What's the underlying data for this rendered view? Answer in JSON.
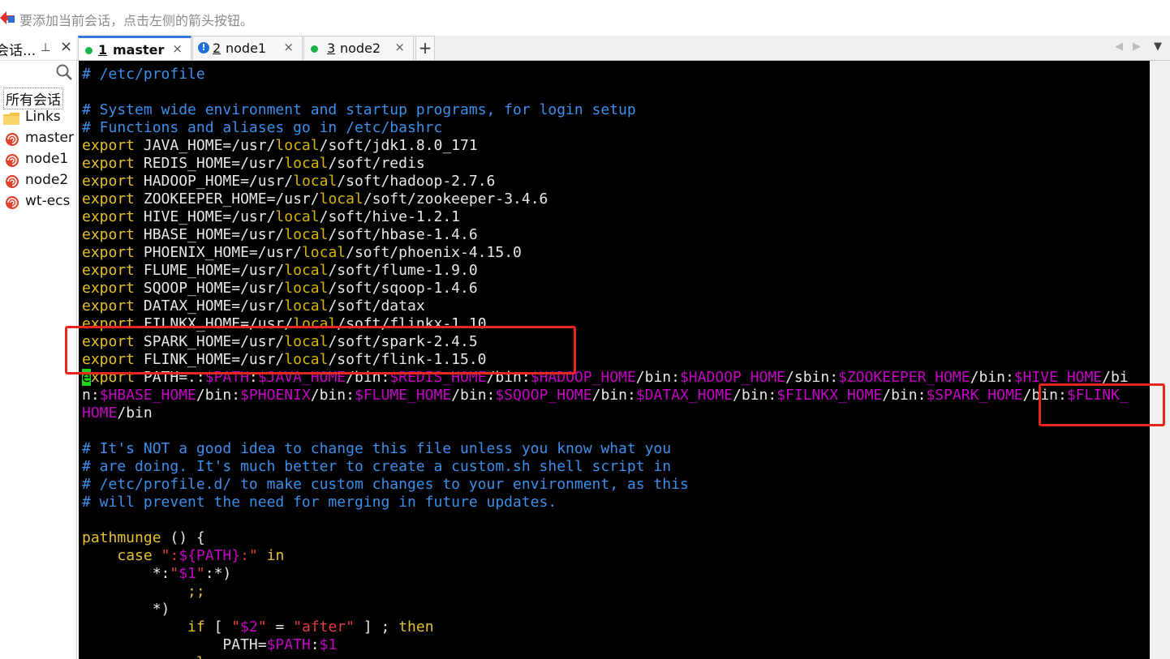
{
  "hint_bar": {
    "text": "要添加当前会话，点击左侧的箭头按钮。"
  },
  "sidebar": {
    "title": "会话...",
    "pin_glyph": "⊥",
    "close_glyph": "×",
    "tree": [
      {
        "label": "所有会话",
        "icon": "none"
      },
      {
        "label": "Links",
        "icon": "folder-icon"
      },
      {
        "label": "master",
        "icon": "session-snail-icon"
      },
      {
        "label": "node1",
        "icon": "session-snail-icon"
      },
      {
        "label": "node2",
        "icon": "session-snail-icon"
      },
      {
        "label": "wt-ecs",
        "icon": "session-snail-icon"
      }
    ]
  },
  "tabs": [
    {
      "num": "1",
      "name": "master",
      "status": "connected",
      "active": true,
      "close": "×"
    },
    {
      "num": "2",
      "name": "node1",
      "status": "warning",
      "active": false,
      "close": "×"
    },
    {
      "num": "3",
      "name": "node2",
      "status": "connected",
      "active": false,
      "close": "×"
    }
  ],
  "tab_controls": {
    "add": "+",
    "prev": "◀",
    "next": "▶",
    "menu": "▼"
  },
  "terminal": {
    "colors": {
      "background": "#000000",
      "comment": "#3b8eea",
      "keyword": "#e5c02a",
      "variable": "#c400c4",
      "string": "#e03c3c",
      "highlight_box": "#e5261b"
    },
    "lines": [
      [
        [
          "c",
          "# /etc/profile"
        ]
      ],
      [],
      [
        [
          "c",
          "# System wide environment and startup programs, for login setup"
        ]
      ],
      [
        [
          "c",
          "# Functions and aliases go in /etc/bashrc"
        ]
      ],
      [
        [
          "k",
          "export"
        ],
        [
          "p",
          " JAVA_HOME=/usr/"
        ],
        [
          "l",
          "local"
        ],
        [
          "p",
          "/soft/jdk1.8.0_171"
        ]
      ],
      [
        [
          "k",
          "export"
        ],
        [
          "p",
          " REDIS_HOME=/usr/"
        ],
        [
          "l",
          "local"
        ],
        [
          "p",
          "/soft/redis"
        ]
      ],
      [
        [
          "k",
          "export"
        ],
        [
          "p",
          " HADOOP_HOME=/usr/"
        ],
        [
          "l",
          "local"
        ],
        [
          "p",
          "/soft/hadoop-2.7.6"
        ]
      ],
      [
        [
          "k",
          "export"
        ],
        [
          "p",
          " ZOOKEEPER_HOME=/usr/"
        ],
        [
          "l",
          "local"
        ],
        [
          "p",
          "/soft/zookeeper-3.4.6"
        ]
      ],
      [
        [
          "k",
          "export"
        ],
        [
          "p",
          " HIVE_HOME=/usr/"
        ],
        [
          "l",
          "local"
        ],
        [
          "p",
          "/soft/hive-1.2.1"
        ]
      ],
      [
        [
          "k",
          "export"
        ],
        [
          "p",
          " HBASE_HOME=/usr/"
        ],
        [
          "l",
          "local"
        ],
        [
          "p",
          "/soft/hbase-1.4.6"
        ]
      ],
      [
        [
          "k",
          "export"
        ],
        [
          "p",
          " PHOENIX_HOME=/usr/"
        ],
        [
          "l",
          "local"
        ],
        [
          "p",
          "/soft/phoenix-4.15.0"
        ]
      ],
      [
        [
          "k",
          "export"
        ],
        [
          "p",
          " FLUME_HOME=/usr/"
        ],
        [
          "l",
          "local"
        ],
        [
          "p",
          "/soft/flume-1.9.0"
        ]
      ],
      [
        [
          "k",
          "export"
        ],
        [
          "p",
          " SQOOP_HOME=/usr/"
        ],
        [
          "l",
          "local"
        ],
        [
          "p",
          "/soft/sqoop-1.4.6"
        ]
      ],
      [
        [
          "k",
          "export"
        ],
        [
          "p",
          " DATAX_HOME=/usr/"
        ],
        [
          "l",
          "local"
        ],
        [
          "p",
          "/soft/datax"
        ]
      ],
      [
        [
          "k",
          "export"
        ],
        [
          "p",
          " FILNKX_HOME=/usr/"
        ],
        [
          "l",
          "local"
        ],
        [
          "p",
          "/soft/flinkx-1.10"
        ]
      ],
      [
        [
          "k",
          "export"
        ],
        [
          "p",
          " SPARK_HOME=/usr/"
        ],
        [
          "l",
          "local"
        ],
        [
          "p",
          "/soft/spark-2.4.5"
        ]
      ],
      [
        [
          "k",
          "export"
        ],
        [
          "p",
          " FLINK_HOME=/usr/"
        ],
        [
          "l",
          "local"
        ],
        [
          "p",
          "/soft/flink-1.15.0"
        ]
      ],
      [
        [
          "cur",
          "e"
        ],
        [
          "k",
          "xport"
        ],
        [
          "p",
          " PATH=.:"
        ],
        [
          "v",
          "$PATH"
        ],
        [
          "p",
          ":"
        ],
        [
          "v",
          "$JAVA_HOME"
        ],
        [
          "p",
          "/bin:"
        ],
        [
          "v",
          "$REDIS_HOME"
        ],
        [
          "p",
          "/bin:"
        ],
        [
          "v",
          "$HADOOP_HOME"
        ],
        [
          "p",
          "/bin:"
        ],
        [
          "v",
          "$HADOOP_HOME"
        ],
        [
          "p",
          "/sbin:"
        ],
        [
          "v",
          "$ZOOKEEPER_HOME"
        ],
        [
          "p",
          "/bin:"
        ],
        [
          "v",
          "$HIVE_HOME"
        ],
        [
          "p",
          "/bi"
        ]
      ],
      [
        [
          "p",
          "n:"
        ],
        [
          "v",
          "$HBASE_HOME"
        ],
        [
          "p",
          "/bin:"
        ],
        [
          "v",
          "$PHOENIX"
        ],
        [
          "p",
          "/bin:"
        ],
        [
          "v",
          "$FLUME_HOME"
        ],
        [
          "p",
          "/bin:"
        ],
        [
          "v",
          "$SQOOP_HOME"
        ],
        [
          "p",
          "/bin:"
        ],
        [
          "v",
          "$DATAX_HOME"
        ],
        [
          "p",
          "/bin:"
        ],
        [
          "v",
          "$FILNKX_HOME"
        ],
        [
          "p",
          "/bin:"
        ],
        [
          "v",
          "$SPARK_HOME"
        ],
        [
          "p",
          "/bin:"
        ],
        [
          "v",
          "$FLINK_"
        ]
      ],
      [
        [
          "v",
          "HOME"
        ],
        [
          "p",
          "/bin"
        ]
      ],
      [],
      [
        [
          "c",
          "# It's NOT a good idea to change this file unless you know what you"
        ]
      ],
      [
        [
          "c",
          "# are doing. It's much better to create a custom.sh shell script in"
        ]
      ],
      [
        [
          "c",
          "# /etc/profile.d/ to make custom changes to your environment, as this"
        ]
      ],
      [
        [
          "c",
          "# will prevent the need for merging in future updates."
        ]
      ],
      [],
      [
        [
          "k",
          "pathmunge"
        ],
        [
          "p",
          " () {"
        ]
      ],
      [
        [
          "p",
          "    "
        ],
        [
          "k",
          "case"
        ],
        [
          "p",
          " "
        ],
        [
          "s",
          "\":"
        ],
        [
          "v",
          "${PATH}"
        ],
        [
          "s",
          ":\""
        ],
        [
          "p",
          " "
        ],
        [
          "k",
          "in"
        ]
      ],
      [
        [
          "p",
          "        *:"
        ],
        [
          "s",
          "\""
        ],
        [
          "v",
          "$1"
        ],
        [
          "s",
          "\""
        ],
        [
          "p",
          ":*)"
        ]
      ],
      [
        [
          "p",
          "            "
        ],
        [
          "k",
          ";;"
        ]
      ],
      [
        [
          "p",
          "        *)"
        ]
      ],
      [
        [
          "p",
          "            "
        ],
        [
          "k",
          "if"
        ],
        [
          "p",
          " [ "
        ],
        [
          "s",
          "\""
        ],
        [
          "v",
          "$2"
        ],
        [
          "s",
          "\""
        ],
        [
          "p",
          " = "
        ],
        [
          "s",
          "\"after\""
        ],
        [
          "p",
          " ] ; "
        ],
        [
          "k",
          "then"
        ]
      ],
      [
        [
          "p",
          "                PATH="
        ],
        [
          "v",
          "$PATH"
        ],
        [
          "p",
          ":"
        ],
        [
          "v",
          "$1"
        ]
      ],
      [
        [
          "p",
          "            "
        ],
        [
          "k",
          "else"
        ]
      ]
    ]
  }
}
